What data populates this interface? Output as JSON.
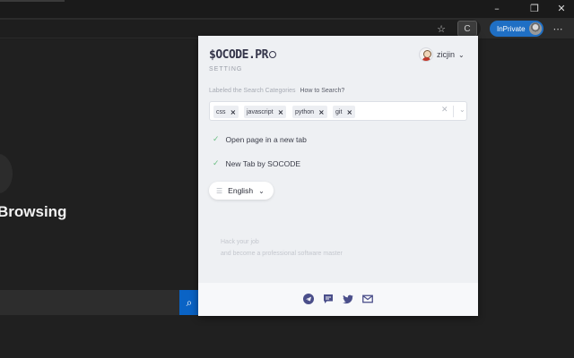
{
  "browser": {
    "inprivate_label": "InPrivate",
    "extension_button_label": "C",
    "window_controls": [
      "minimize-icon",
      "restore-icon",
      "close-icon"
    ],
    "toolbar_icons": [
      "favorite-star-icon",
      "more-menu-icon"
    ]
  },
  "background_page": {
    "heading_fragment": "Browsing",
    "search_button_icon": "search-icon"
  },
  "popup": {
    "logo": {
      "brand": "$OCODE.PR",
      "suffix_icon": "ring-o-icon"
    },
    "section_label": "SETTING",
    "user": {
      "name": "zicjin",
      "avatar_icon": "user-avatar-icon",
      "menu_icon": "chevron-down-icon"
    },
    "search_categories": {
      "label": "Labeled the Search Categories",
      "help_link": "How to Search?",
      "tags": [
        "css",
        "javascript",
        "python",
        "git"
      ],
      "clear_icon": "clear-x-icon",
      "dropdown_icon": "chevron-down-icon"
    },
    "options": [
      {
        "label": "Open page in a new tab",
        "checked": true
      },
      {
        "label": "New Tab by SOCODE",
        "checked": true
      }
    ],
    "language": {
      "selected": "English",
      "icon": "language-icon"
    },
    "quote": {
      "line1": "Hack your job",
      "line2": "and become a professional software master"
    },
    "footer_icons": [
      "telegram-icon",
      "chat-icon",
      "twitter-icon",
      "email-icon"
    ],
    "colors": {
      "check": "#6cbf84",
      "footer_icon": "#4a4e8a",
      "inprivate": "#1f6fc4",
      "search_button": "#0a63c5"
    }
  }
}
